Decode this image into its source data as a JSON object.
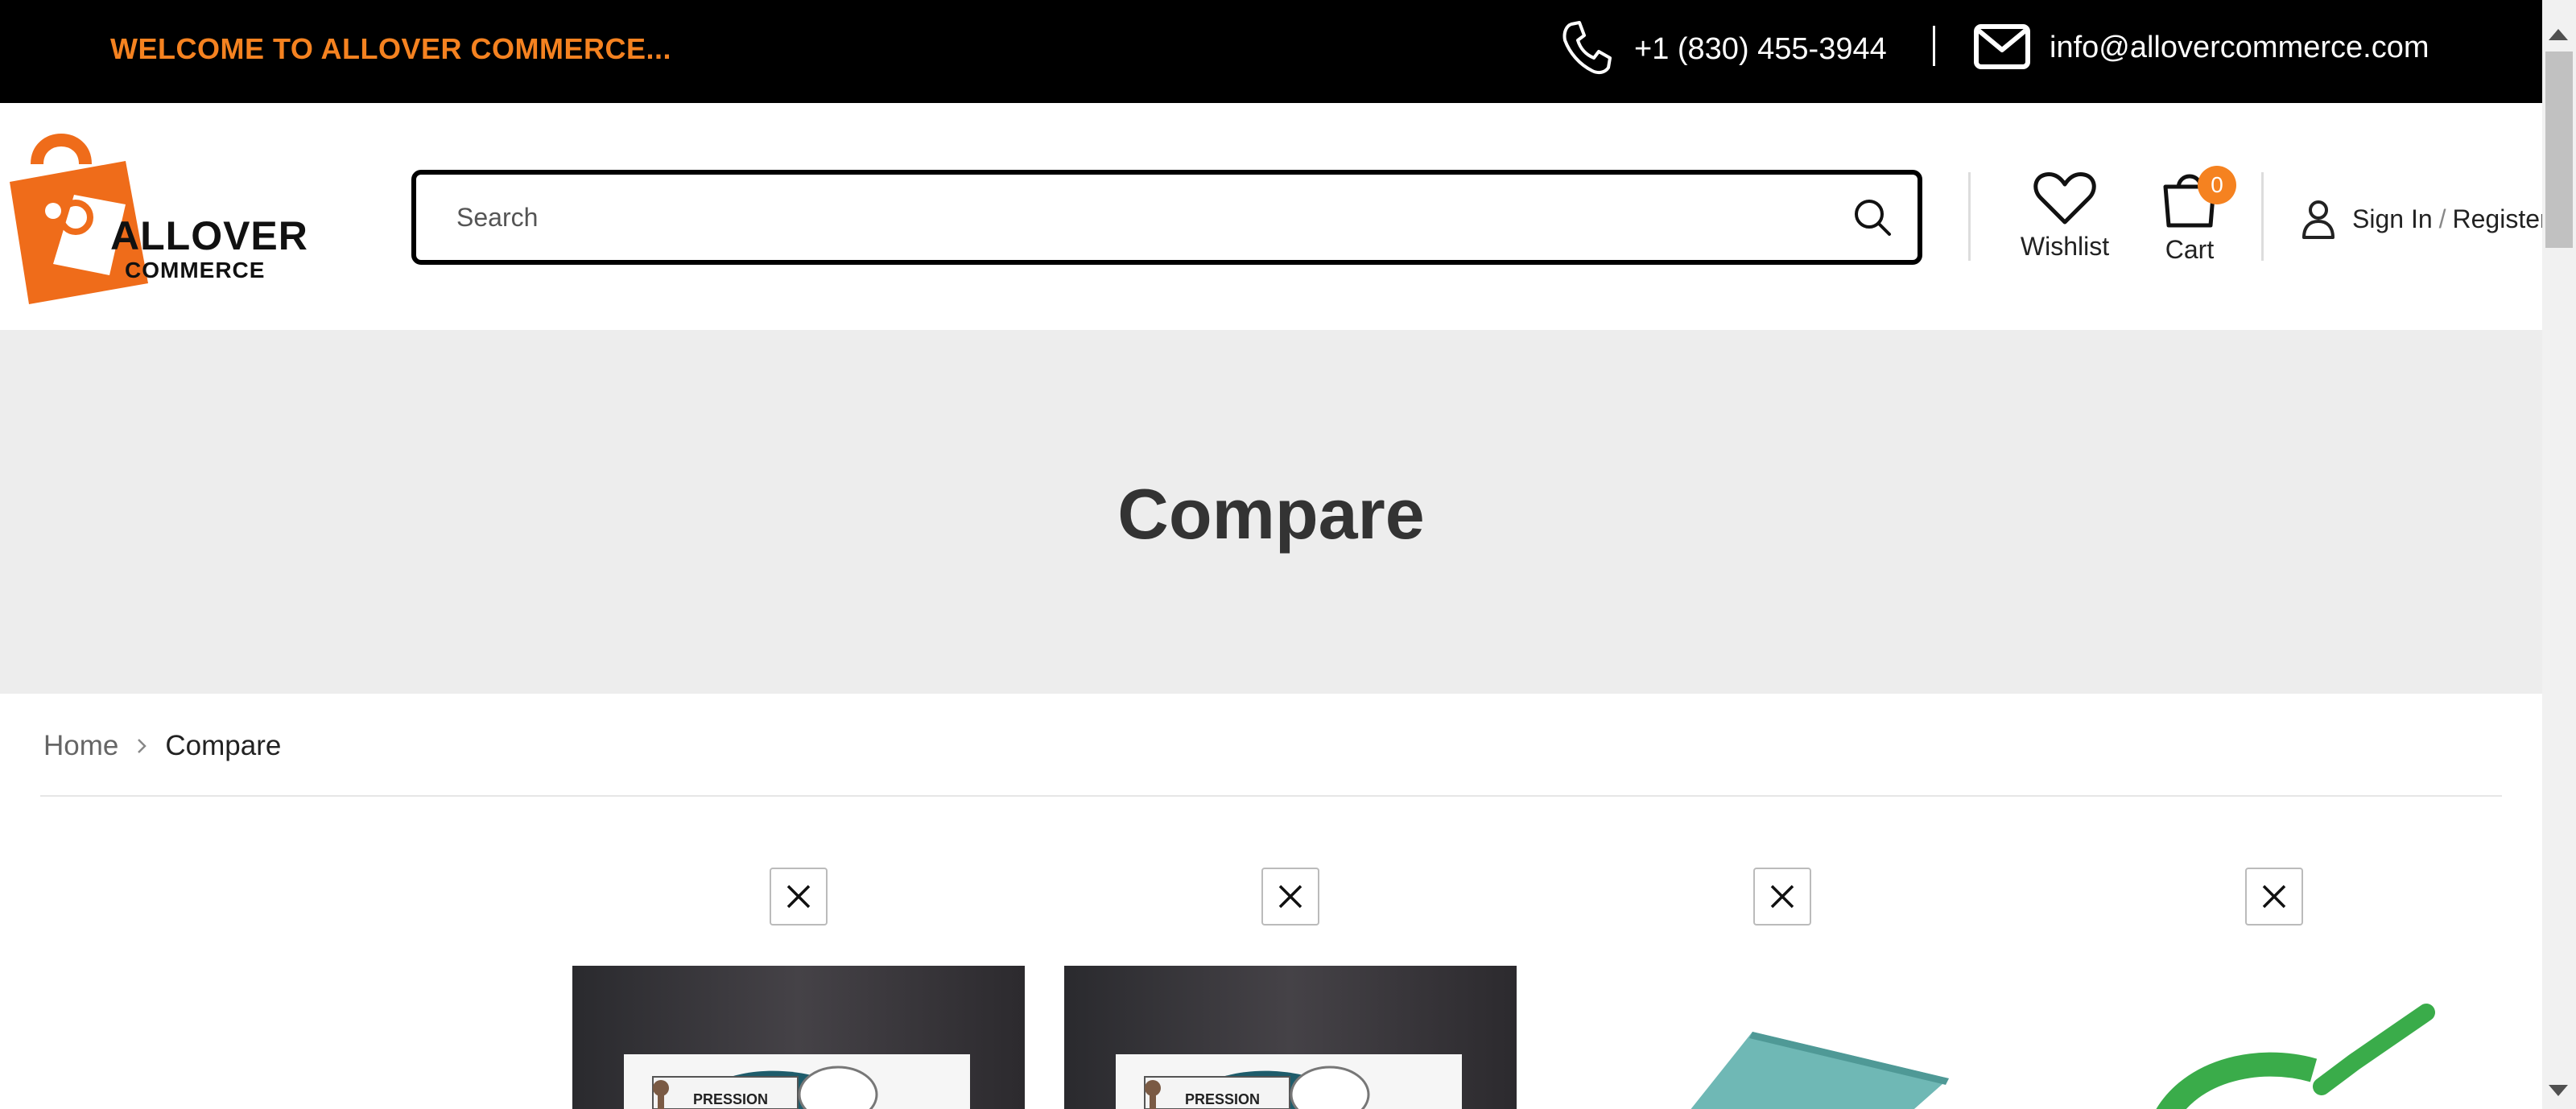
{
  "topbar": {
    "welcome": "WELCOME TO ALLOVER COMMERCE...",
    "phone": "+1 (830) 455-3944",
    "email": "info@allovercommerce.com",
    "welcome_color": "#f58220"
  },
  "logo": {
    "line1": "ALLOVER",
    "line2": "COMMERCE",
    "brand_color": "#ef6c1a"
  },
  "search": {
    "placeholder": "Search"
  },
  "header": {
    "wishlist_label": "Wishlist",
    "cart_label": "Cart",
    "cart_count": "0",
    "sign_in": "Sign In",
    "slash": "/",
    "register": "Register"
  },
  "page": {
    "title": "Compare"
  },
  "breadcrumb": {
    "home": "Home",
    "current": "Compare"
  },
  "compare_items": [
    {
      "image": "book-cover-dark-chef-illustration"
    },
    {
      "image": "book-cover-dark-chef-illustration"
    },
    {
      "image": "teal-notebook"
    },
    {
      "image": "green-check-logo"
    }
  ]
}
